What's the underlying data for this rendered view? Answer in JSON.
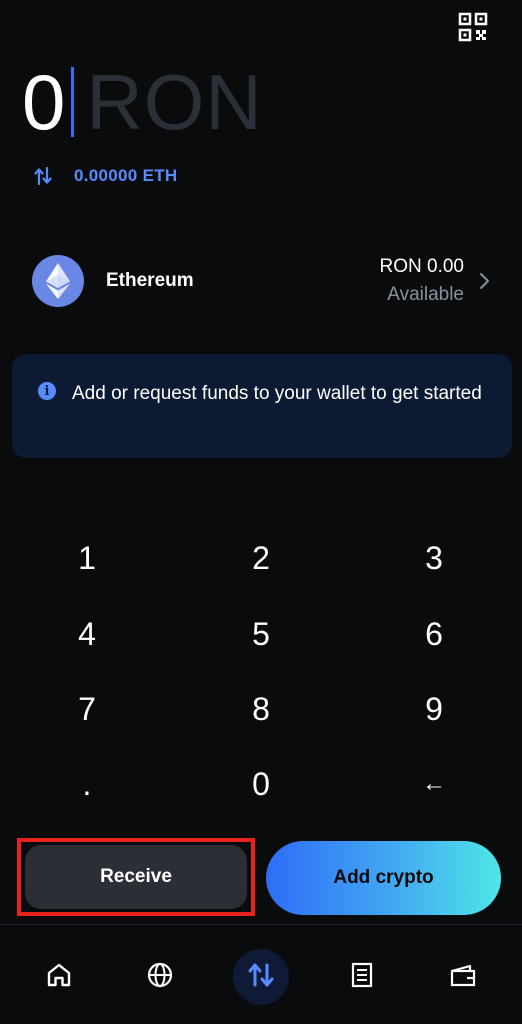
{
  "header": {
    "qr_icon": "qr-code-icon"
  },
  "amount": {
    "value": "0",
    "unit": "RON"
  },
  "conversion": {
    "text": "0.00000 ETH",
    "icon": "swap-vertical-icon"
  },
  "asset": {
    "name": "Ethereum",
    "balance": "RON 0.00",
    "available_label": "Available",
    "logo_icon": "ethereum-logo-icon",
    "logo_color": "#6b87e5"
  },
  "info_banner": {
    "text": "Add or request funds to your wallet to get started",
    "icon": "info-icon"
  },
  "keypad": {
    "keys": [
      "1",
      "2",
      "3",
      "4",
      "5",
      "6",
      "7",
      "8",
      "9",
      ".",
      "0",
      "←"
    ]
  },
  "actions": {
    "receive_label": "Receive",
    "add_crypto_label": "Add crypto"
  },
  "nav": {
    "items": [
      {
        "icon": "home-icon"
      },
      {
        "icon": "globe-icon"
      },
      {
        "icon": "trade-icon",
        "active": true
      },
      {
        "icon": "activity-icon"
      },
      {
        "icon": "wallet-icon"
      }
    ]
  },
  "colors": {
    "background": "#0a0b0d",
    "accent": "#588bff",
    "banner": "#0c1a33",
    "highlight": "#e8231c"
  }
}
